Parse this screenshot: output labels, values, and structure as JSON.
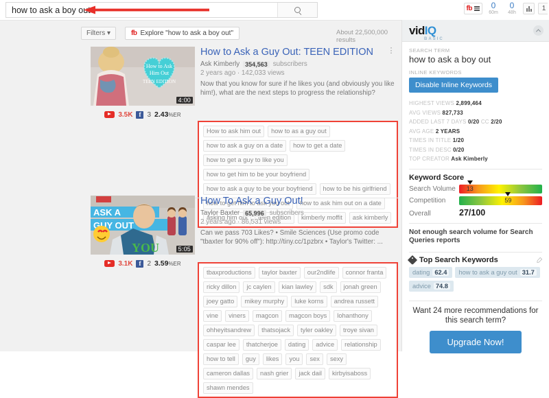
{
  "topbar": {
    "search_value": "how to ask a boy out",
    "search_placeholder": "Search",
    "search_icon": "search-icon",
    "annotation_arrow_color": "#e8302a",
    "vidiq_badge_text": "vIQ",
    "counters": [
      {
        "num": "0",
        "label": "60m"
      },
      {
        "num": "0",
        "label": "48h"
      }
    ]
  },
  "results_bar": {
    "filters_label": "Filters",
    "explore_label": "Explore \"how to ask a boy out\"",
    "results_count": "About 22,500,000 results"
  },
  "videos": [
    {
      "title": "How to Ask a Guy Out: TEEN EDITION",
      "channel": "Ask Kimberly",
      "subscribers": "354,563",
      "subscribers_label": "subscribers",
      "age": "2 years ago",
      "views": "142,033 views",
      "description": "Now that you know for sure if he likes you (and obviously you like him!), what are the next steps to progress the relationship?",
      "duration": "4:00",
      "yt_stat": "3.5K",
      "fb_stat": "3",
      "er_stat": "2.43",
      "er_suffix": "%ER",
      "thumb_text_1": "How to Ask",
      "thumb_text_2": "Him Out",
      "thumb_text_3": "TEEN EDITION",
      "tags": [
        "How to ask him out",
        "how to as a guy out",
        "how to ask a guy on a date",
        "how to get a date",
        "how to get a guy to like you",
        "how to get him to be your boyfriend",
        "how to ask a guy to be your boyfriend",
        "how to be his girlfriend",
        "how to get him to ask you out",
        "how to ask him out on a date",
        "asking him out",
        "teen edition",
        "kimberly moffit",
        "ask kimberly"
      ]
    },
    {
      "title": "How To Ask a Guy Out!",
      "channel": "Taylor Baxter",
      "subscribers": "65,996",
      "subscribers_label": "subscribers",
      "age": "2 years ago",
      "views": "86,531 views",
      "description": "Can we pass 703 Likes? • Smile Sciences (Use promo code \"tbaxter for 90% off\"): http://tiny.cc/1pzbrx • Taylor's Twitter: ...",
      "duration": "5:05",
      "yt_stat": "3.1K",
      "fb_stat": "2",
      "er_stat": "3.59",
      "er_suffix": "%ER",
      "thumb_text_1": "ASK A",
      "thumb_text_2": "GUY OUT",
      "thumb_text_3": "YOU",
      "tags": [
        "tbaxproductions",
        "taylor baxter",
        "our2ndlife",
        "connor franta",
        "ricky dillon",
        "jc caylen",
        "kian lawley",
        "sdk",
        "jonah green",
        "joey gatto",
        "mikey murphy",
        "luke korns",
        "andrea russett",
        "vine",
        "viners",
        "magcon",
        "magcon boys",
        "lohanthony",
        "ohheyitsandrew",
        "thatsojack",
        "tyler oakley",
        "troye sivan",
        "caspar lee",
        "thatcherjoe",
        "dating",
        "advice",
        "relationship",
        "how to tell",
        "guy",
        "likes",
        "you",
        "sex",
        "sexy",
        "cameron dallas",
        "nash grier",
        "jack dail",
        "kirbyisaboss",
        "shawn mendes"
      ]
    }
  ],
  "sidebar": {
    "logo_main": "vid",
    "logo_accent": "IQ",
    "logo_sub": "BASIC",
    "search_term_label": "SEARCH TERM",
    "search_term": "how to ask a boy out",
    "inline_keywords_label": "INLINE KEYWORDS",
    "disable_button": "Disable Inline Keywords",
    "stats": [
      {
        "label": "HIGHEST VIEWS",
        "value": "2,899,464"
      },
      {
        "label": "AVG VIEWS",
        "value": "827,733"
      },
      {
        "label": "ADDED LAST 7 DAYS",
        "value": "0/20",
        "label2": "CC",
        "value2": "2/20"
      },
      {
        "label": "AVG AGE",
        "value": "2 YEARS"
      },
      {
        "label": "TIMES IN TITLE",
        "value": "1/20"
      },
      {
        "label": "TIMES IN DESC",
        "value": "0/20"
      },
      {
        "label": "TOP CREATOR",
        "value": "Ask Kimberly"
      }
    ],
    "keyword_score_title": "Keyword Score",
    "search_volume_label": "Search Volume",
    "search_volume_value": "13",
    "competition_label": "Competition",
    "competition_value": "59",
    "overall_label": "Overall",
    "overall_value": "27/100",
    "notice": "Not enough search volume for Search Queries reports",
    "top_keywords_title": "Top Search Keywords",
    "top_keywords": [
      {
        "term": "dating",
        "score": "62.4"
      },
      {
        "term": "how to ask a guy out",
        "score": "31.7"
      },
      {
        "term": "advice",
        "score": "74.8"
      }
    ],
    "upsell_text": "Want 24 more recommendations for this search term?",
    "upgrade_button": "Upgrade Now!",
    "accent_color": "#3e8ecc",
    "highlight_color": "#ef4136"
  }
}
